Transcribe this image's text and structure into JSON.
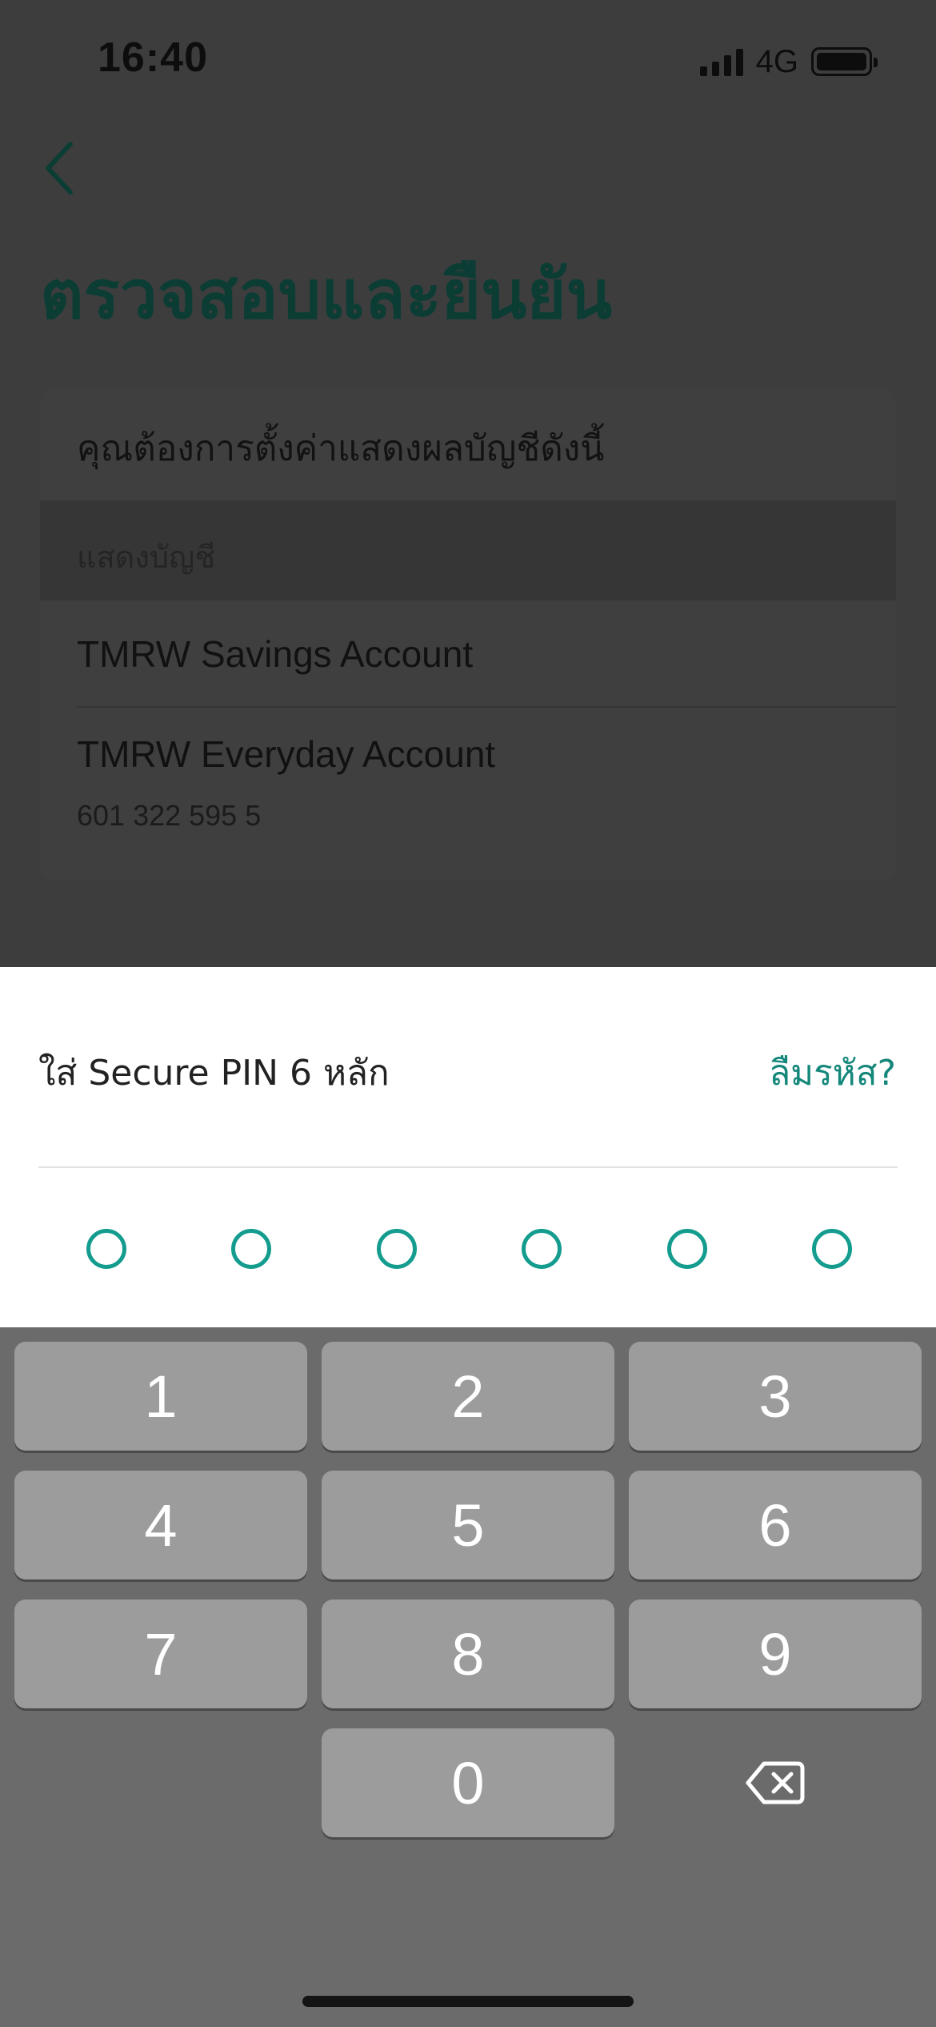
{
  "status_bar": {
    "time": "16:40",
    "network": "4G"
  },
  "header": {
    "back_icon": "chevron-left-icon",
    "title": "ตรวจสอบและยืนยัน"
  },
  "confirm_card": {
    "question": "คุณต้องการตั้งค่าแสดงผลบัญชีดังนี้",
    "section_label": "แสดงบัญชี",
    "accounts": [
      {
        "name": "TMRW Savings Account"
      },
      {
        "name": "TMRW Everyday Account",
        "number": "601 322 595 5"
      }
    ]
  },
  "pin_sheet": {
    "prompt": "ใส่ Secure PIN 6 หลัก",
    "forgot_label": "ลืมรหัส?",
    "accent_color": "#149c8e",
    "pin_length": 6,
    "entered_digits": 0
  },
  "keypad": {
    "keys": [
      "1",
      "2",
      "3",
      "4",
      "5",
      "6",
      "7",
      "8",
      "9",
      "0"
    ],
    "backspace_icon": "backspace-icon"
  }
}
